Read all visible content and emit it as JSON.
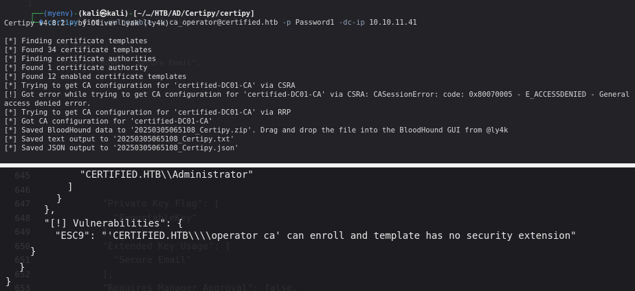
{
  "terminal": {
    "prompt": {
      "frame_top": "┌──",
      "env": "(myenv)",
      "dash": "-",
      "user_host": "(kali㉿kali)",
      "dash2": "-",
      "path": "[~/…/HTB/AD/Certipy/certipy]",
      "frame_bottom": "└─",
      "dollar": "$"
    },
    "command": {
      "program": "certipy",
      "subcommand": "find",
      "flag_vuln": "-vulnerable",
      "flag_u": "-u",
      "user": "ca_operator@certified.htb",
      "flag_p": "-p",
      "password": "Password1",
      "flag_dc": "-dc-ip",
      "ip": "10.10.11.41"
    },
    "output": [
      "Certipy v4.8.2 - by Oliver Lyak (ly4k)",
      "",
      "[*] Finding certificate templates",
      "[*] Found 34 certificate templates",
      "[*] Finding certificate authorities",
      "[*] Found 1 certificate authority",
      "[*] Found 12 enabled certificate templates",
      "[*] Trying to get CA configuration for 'certified-DC01-CA' via CSRA",
      "[!] Got error while trying to get CA configuration for 'certified-DC01-CA' via CSRA: CASessionError: code: 0x80070005 - E_ACCESSDENIED - General",
      "access denied error.",
      "[*] Trying to get CA configuration for 'certified-DC01-CA' via RRP",
      "[*] Got CA configuration for 'certified-DC01-CA'",
      "[*] Saved BloodHound data to '20250305065108_Certipy.zip'. Drag and drop the file into the BloodHound GUI from @ly4k",
      "[*] Saved text output to '20250305065108_Certipy.txt'",
      "[*] Saved JSON output to '20250305065108_Certipy.json'"
    ],
    "background_ghost": [
      "1",
      "",
      "      \"Enrollment Service\": \"Certified Domain\"",
      "",
      "",
      "      \"CA Name\": [",
      "",
      "      \"Template Name\": \"Secure Email\",",
      "",
      "",
      "",
      "",
      "",
      "",
      "",
      "",
      "",
      "",
      ""
    ]
  },
  "editor": {
    "gutter_numbers": [
      "645",
      "646",
      "647",
      "648",
      "649",
      "650",
      "651",
      "652",
      "653"
    ],
    "ghost_lines": [
      "",
      "",
      "      \"Private Key Flag\": [",
      "        \"ExportableKey\"",
      "      ],",
      "      \"Extended Key Usage\": [",
      "        \"Secure Email\"",
      "      ],",
      "      \"Requires Manager Approval\": false,"
    ],
    "lines": [
      "\"CERTIFIED.HTB\\\\Administrator\"",
      "]",
      "}",
      "},",
      "\"[!] Vulnerabilities\": {",
      "\"ESC9\": \"'CERTIFIED.HTB\\\\\\\\operator ca' can enroll and template has no security extension\"",
      "}",
      "}",
      "}"
    ]
  }
}
